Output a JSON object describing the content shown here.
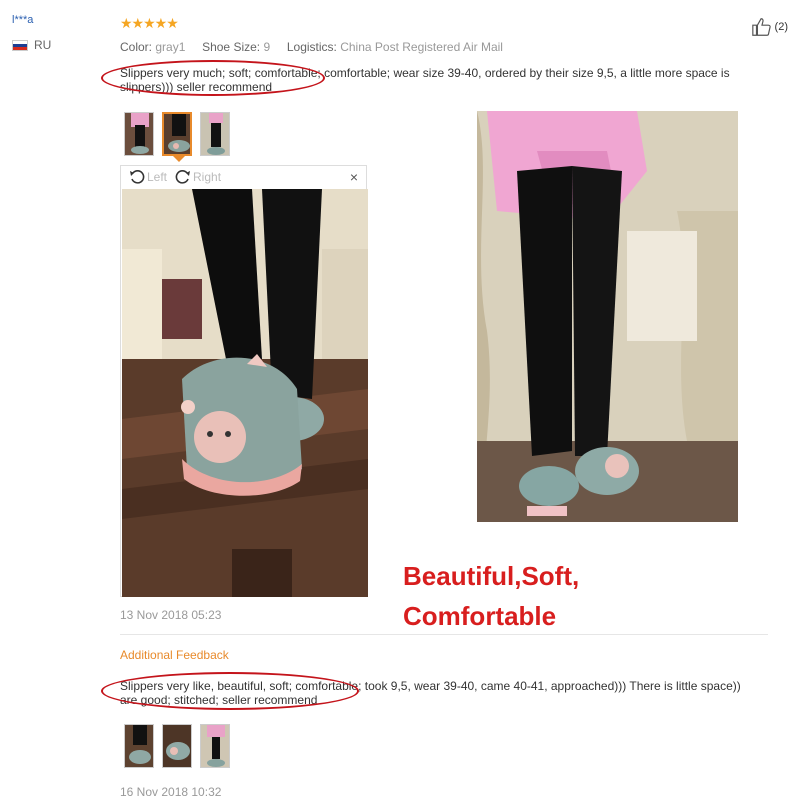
{
  "user": {
    "name": "l***a",
    "country": "RU"
  },
  "review": {
    "stars": "★★★★★",
    "helpful_count": "(2)",
    "color_label": "Color:",
    "color_value": "gray1",
    "size_label": "Shoe Size:",
    "size_value": "9",
    "logistics_label": "Logistics:",
    "logistics_value": "China Post Registered Air Mail",
    "text": "Slippers very much; soft; comfortable; comfortable; wear size 39-40, ordered by their size 9,5, a little more space is slippers))) seller recommend",
    "date": "13 Nov 2018 05:23"
  },
  "viewer": {
    "left_label": "Left",
    "right_label": "Right",
    "close": "×"
  },
  "promo": {
    "line1": "Beautiful,Soft,",
    "line2": "Comfortable"
  },
  "additional": {
    "title": "Additional Feedback",
    "text": "Slippers very like, beautiful, soft; comfortable; took 9,5, wear 39-40, came 40-41, approached))) There is little space)) are good; stitched; seller recommend",
    "date": "16 Nov 2018 10:32"
  },
  "colors": {
    "accent_orange": "#e88a2b",
    "star": "#f5a623",
    "highlight_red": "#c4141b",
    "promo_red": "#d81e1e",
    "link_blue": "#2a5fb0"
  }
}
